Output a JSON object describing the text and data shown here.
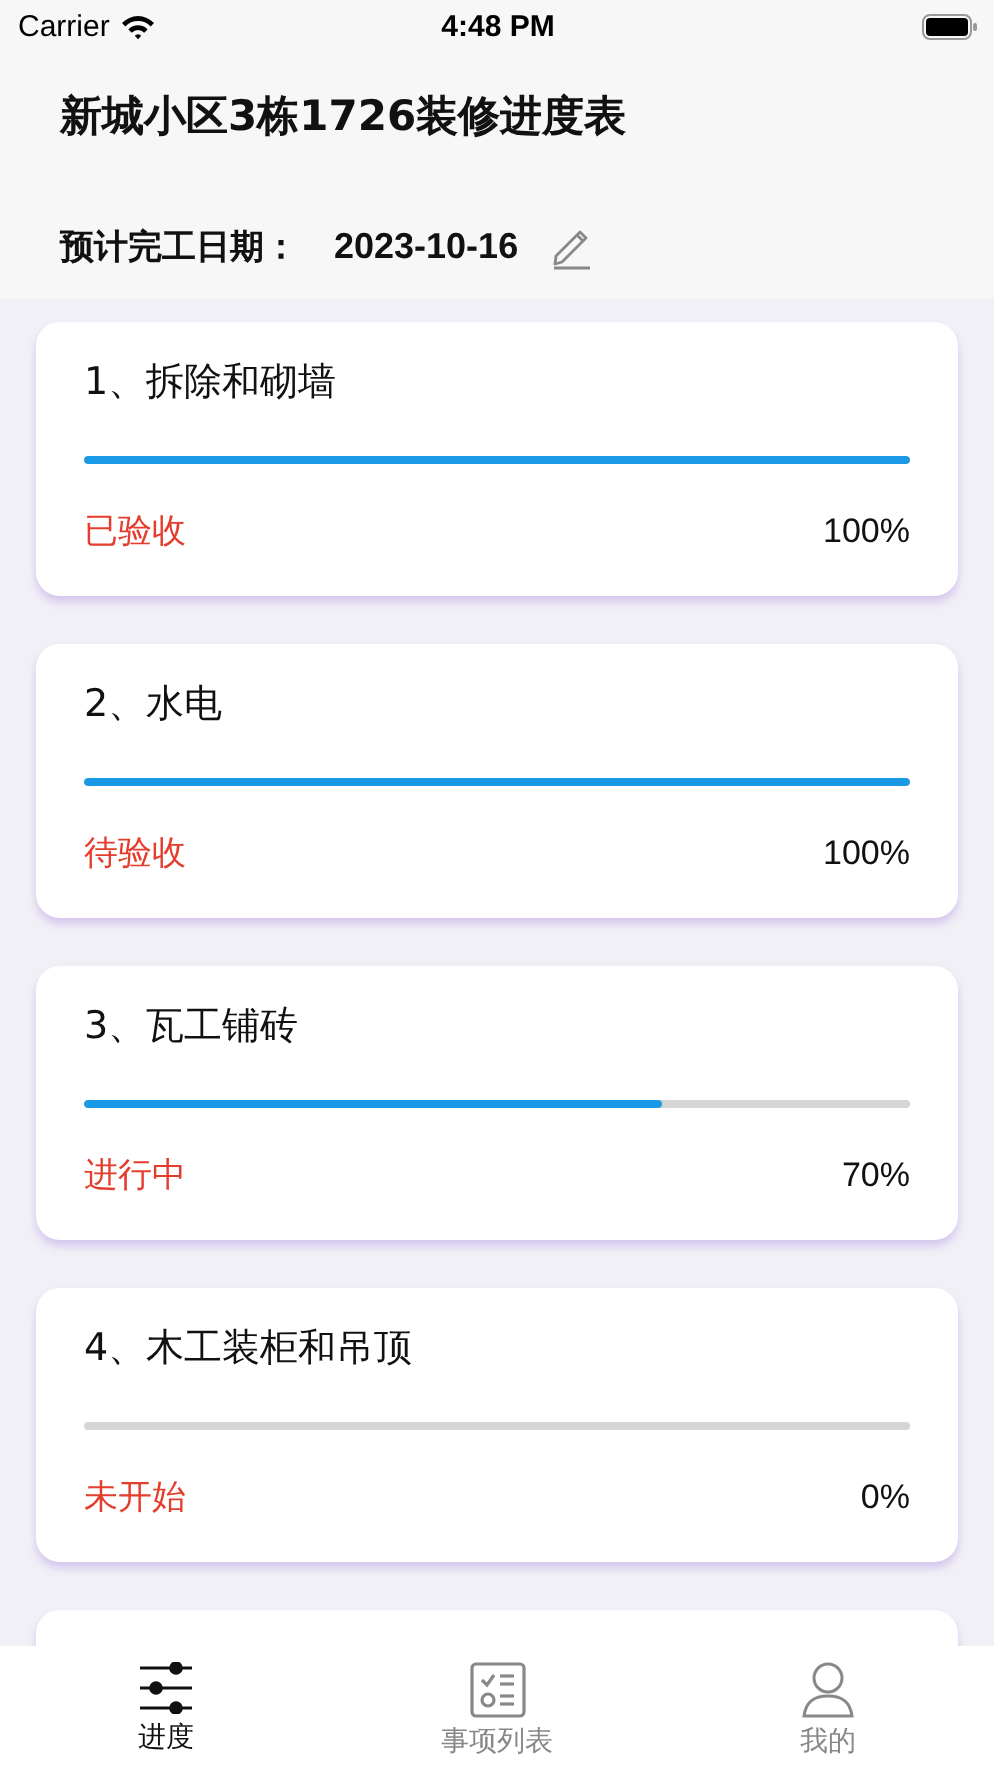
{
  "status_bar": {
    "carrier": "Carrier",
    "time": "4:48 PM"
  },
  "header": {
    "title": "新城小区3栋1726装修进度表",
    "date_label": "预计完工日期：",
    "date_value": "2023-10-16"
  },
  "stages": [
    {
      "title": "1、拆除和砌墙",
      "status": "已验收",
      "level": 1.0,
      "percent": "100%"
    },
    {
      "title": "2、水电",
      "status": "待验收",
      "level": 1.0,
      "percent": "100%"
    },
    {
      "title": "3、瓦工铺砖",
      "status": "进行中",
      "level": 0.7,
      "percent": "70%"
    },
    {
      "title": "4、木工装柜和吊顶",
      "status": "未开始",
      "level": 0.0,
      "percent": "0%"
    }
  ],
  "tabs": [
    {
      "label": "进度",
      "kind": "sliders",
      "selected": true
    },
    {
      "label": "事项列表",
      "kind": "checklist",
      "selected": false
    },
    {
      "label": "我的",
      "kind": "person",
      "selected": false
    }
  ]
}
